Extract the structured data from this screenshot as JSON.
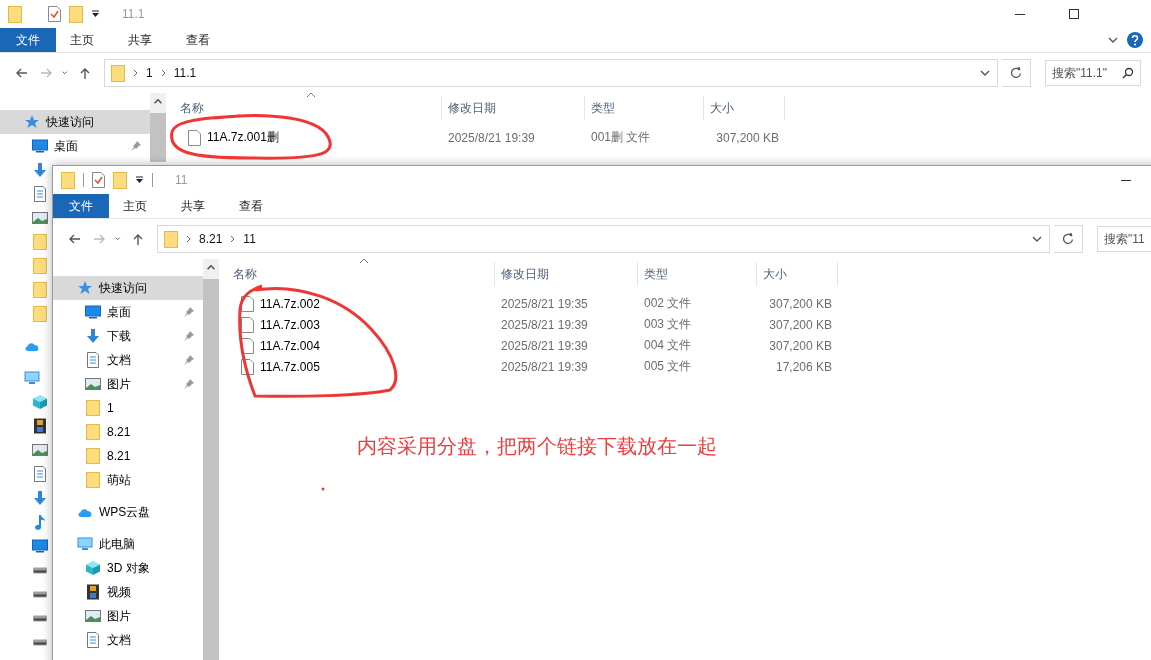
{
  "windows": [
    {
      "title": "11.1",
      "ribbon_tabs": [
        {
          "label": "文件",
          "selected": true
        },
        {
          "label": "主页",
          "selected": false
        },
        {
          "label": "共享",
          "selected": false
        },
        {
          "label": "查看",
          "selected": false
        }
      ],
      "path": [
        "1",
        "11.1"
      ],
      "search": {
        "placeholder": "搜索\"11.1\""
      },
      "nav": [
        {
          "kind": "star",
          "label": "快速访问",
          "selected": true,
          "pinned": false,
          "children": [
            {
              "kind": "desktop",
              "label": "桌面",
              "selected": false,
              "pinned": true
            },
            {
              "kind": "download",
              "selected": false,
              "pinned": false
            },
            {
              "kind": "document",
              "selected": false,
              "pinned": false
            },
            {
              "kind": "picture",
              "selected": false,
              "pinned": false
            },
            {
              "kind": "folder",
              "selected": false,
              "pinned": false
            },
            {
              "kind": "folder",
              "selected": false,
              "pinned": false
            },
            {
              "kind": "folder",
              "selected": false,
              "pinned": false
            },
            {
              "kind": "folder",
              "selected": false,
              "pinned": false
            }
          ]
        },
        {
          "kind": "cloud",
          "selected": false,
          "pinned": false
        },
        {
          "kind": "computer",
          "selected": false,
          "pinned": false,
          "children": [
            {
              "kind": "cube",
              "selected": false,
              "pinned": false
            },
            {
              "kind": "film",
              "selected": false,
              "pinned": false
            },
            {
              "kind": "picture",
              "selected": false,
              "pinned": false
            },
            {
              "kind": "document",
              "selected": false,
              "pinned": false
            },
            {
              "kind": "download",
              "selected": false,
              "pinned": false
            },
            {
              "kind": "music",
              "selected": false,
              "pinned": false
            },
            {
              "kind": "desktop",
              "selected": false,
              "pinned": false
            },
            {
              "kind": "drive",
              "selected": false,
              "pinned": false
            },
            {
              "kind": "drive",
              "selected": false,
              "pinned": false
            },
            {
              "kind": "drive",
              "selected": false,
              "pinned": false
            },
            {
              "kind": "drive",
              "selected": false,
              "pinned": false
            }
          ]
        }
      ],
      "columns": [
        "名称",
        "修改日期",
        "类型",
        "大小"
      ],
      "files": [
        {
          "name": "11A.7z.001删",
          "date": "2025/8/21 19:39",
          "type": "001删 文件",
          "size": "307,200 KB"
        }
      ]
    },
    {
      "title": "11",
      "ribbon_tabs": [
        {
          "label": "文件",
          "selected": true
        },
        {
          "label": "主页",
          "selected": false
        },
        {
          "label": "共享",
          "selected": false
        },
        {
          "label": "查看",
          "selected": false
        }
      ],
      "path": [
        "8.21",
        "11"
      ],
      "search": {
        "placeholder": "搜索\"11"
      },
      "nav": [
        {
          "kind": "star",
          "label": "快速访问",
          "selected": true,
          "pinned": false,
          "children": [
            {
              "kind": "desktop",
              "label": "桌面",
              "selected": false,
              "pinned": true
            },
            {
              "kind": "download",
              "label": "下载",
              "selected": false,
              "pinned": true
            },
            {
              "kind": "document",
              "label": "文档",
              "selected": false,
              "pinned": true
            },
            {
              "kind": "picture",
              "label": "图片",
              "selected": false,
              "pinned": true
            },
            {
              "kind": "folder",
              "label": "1",
              "selected": false,
              "pinned": false
            },
            {
              "kind": "folder",
              "label": "8.21",
              "selected": false,
              "pinned": false
            },
            {
              "kind": "folder",
              "label": "8.21",
              "selected": false,
              "pinned": false
            },
            {
              "kind": "folder",
              "label": "萌站",
              "selected": false,
              "pinned": false
            }
          ]
        },
        {
          "kind": "cloud",
          "label": "WPS云盘",
          "selected": false,
          "pinned": false
        },
        {
          "kind": "computer",
          "label": "此电脑",
          "selected": false,
          "pinned": false,
          "children": [
            {
              "kind": "cube",
              "label": "3D 对象",
              "selected": false,
              "pinned": false
            },
            {
              "kind": "film",
              "label": "视频",
              "selected": false,
              "pinned": false
            },
            {
              "kind": "picture",
              "label": "图片",
              "selected": false,
              "pinned": false
            },
            {
              "kind": "document",
              "label": "文档",
              "selected": false,
              "pinned": false
            }
          ]
        }
      ],
      "columns": [
        "名称",
        "修改日期",
        "类型",
        "大小"
      ],
      "files": [
        {
          "name": "11A.7z.002",
          "date": "2025/8/21 19:35",
          "type": "002 文件",
          "size": "307,200 KB"
        },
        {
          "name": "11A.7z.003",
          "date": "2025/8/21 19:39",
          "type": "003 文件",
          "size": "307,200 KB"
        },
        {
          "name": "11A.7z.004",
          "date": "2025/8/21 19:39",
          "type": "004 文件",
          "size": "307,200 KB"
        },
        {
          "name": "11A.7z.005",
          "date": "2025/8/21 19:39",
          "type": "005 文件",
          "size": "17,206 KB"
        }
      ]
    }
  ],
  "annotation": {
    "text": "内容采用分盘，把两个链接下载放在一起"
  }
}
